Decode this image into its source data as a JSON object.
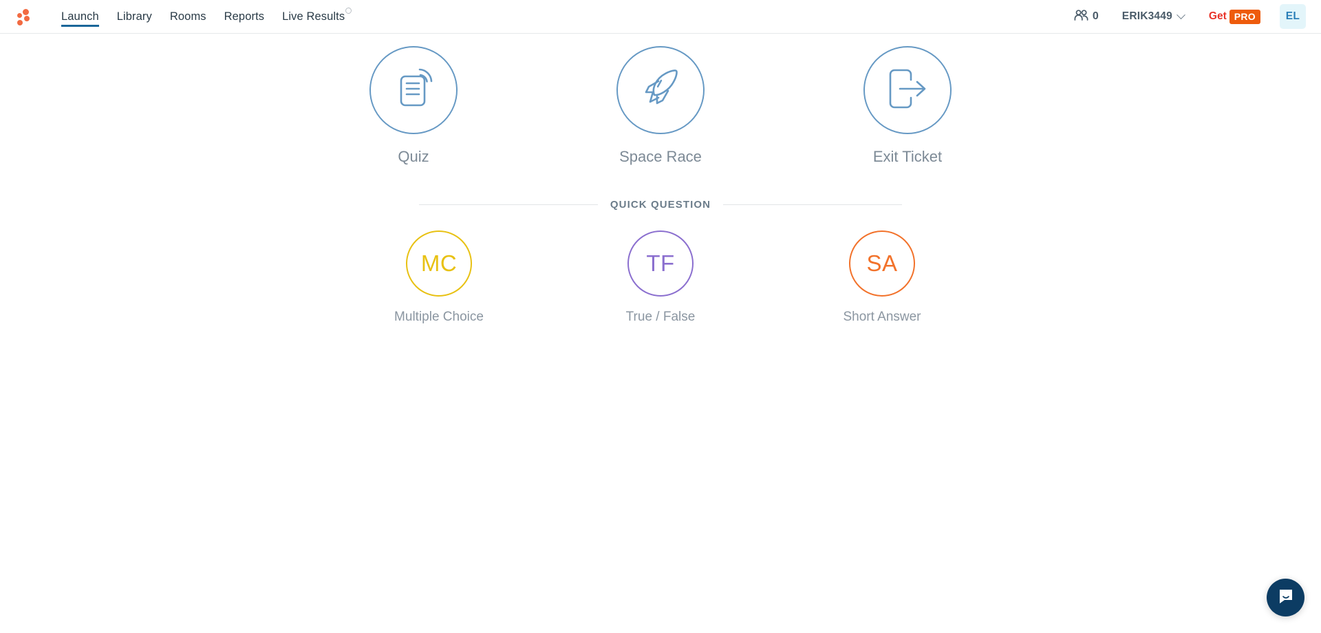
{
  "navbar": {
    "logo_icon": "socrative-dots-logo",
    "links": [
      {
        "label": "Launch",
        "active": true
      },
      {
        "label": "Library",
        "active": false
      },
      {
        "label": "Rooms",
        "active": false
      },
      {
        "label": "Reports",
        "active": false
      },
      {
        "label": "Live Results",
        "active": false
      }
    ],
    "people_icon": "people-icon",
    "people_count": "0",
    "username": "ERIK3449",
    "chevron_icon": "chevron-down-icon",
    "get_label": "Get",
    "pro_label": "PRO",
    "avatar_initials": "EL",
    "active_underline_color": "#1a6699",
    "brand_color": "#f26b42",
    "get_color": "#e8342a",
    "pro_badge_color": "#ee5b0c",
    "avatar_bg": "#e3f5fa",
    "avatar_fg": "#2b7fb8"
  },
  "activities": {
    "ring_color": "#6699c4",
    "items": [
      {
        "label": "Quiz",
        "icon": "quiz-broadcast-icon"
      },
      {
        "label": "Space Race",
        "icon": "rocket-icon"
      },
      {
        "label": "Exit Ticket",
        "icon": "exit-door-arrow-icon"
      }
    ]
  },
  "quick_question": {
    "section_title": "QUICK QUESTION",
    "items": [
      {
        "abbr": "MC",
        "label": "Multiple Choice",
        "color": "#e8c113"
      },
      {
        "abbr": "TF",
        "label": "True / False",
        "color": "#8b6fcf"
      },
      {
        "abbr": "SA",
        "label": "Short Answer",
        "color": "#f2722b"
      }
    ]
  },
  "chat": {
    "icon": "chat-bubble-icon",
    "bg_color": "#0c3c63"
  }
}
